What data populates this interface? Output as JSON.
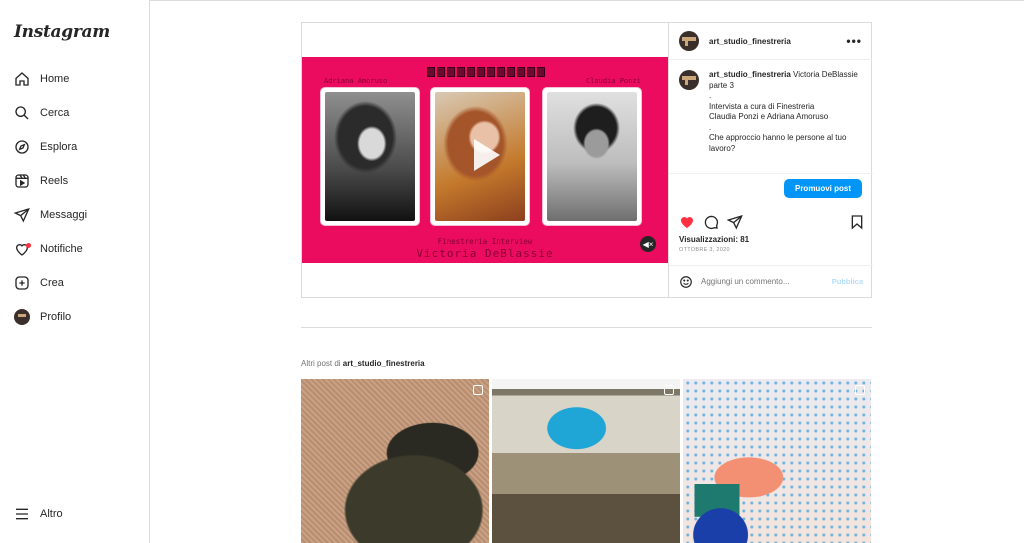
{
  "app": {
    "logo": "Instagram"
  },
  "sidebar": {
    "items": [
      {
        "label": "Home",
        "icon": "home-icon"
      },
      {
        "label": "Cerca",
        "icon": "search-icon"
      },
      {
        "label": "Esplora",
        "icon": "compass-icon"
      },
      {
        "label": "Reels",
        "icon": "reels-icon"
      },
      {
        "label": "Messaggi",
        "icon": "send-icon"
      },
      {
        "label": "Notifiche",
        "icon": "heart-icon"
      },
      {
        "label": "Crea",
        "icon": "plus-square-icon"
      },
      {
        "label": "Profilo",
        "icon": "avatar"
      }
    ],
    "more": {
      "label": "Altro",
      "icon": "menu-icon"
    }
  },
  "post": {
    "username": "art_studio_finestreria",
    "more_icon": "more-horizontal-icon",
    "media": {
      "left_name": "Adriana Amoruso",
      "right_name": "Claudia Ponzi",
      "series": "Finestreria Interview",
      "subject": "Victoria DeBlassie",
      "play_icon": "play-icon",
      "mute_icon": "mute-icon",
      "colors": {
        "background": "#ec0c5f"
      }
    },
    "caption": {
      "username": "art_studio_finestreria",
      "lines": [
        " Victoria DeBlassie",
        "parte 3",
        ".",
        "Intervista a cura di Finestreria",
        "Claudia Ponzi e Adriana Amoruso",
        ".",
        "Che approccio hanno le persone al tuo lavoro?"
      ]
    },
    "promote_label": "Promuovi post",
    "views": "Visualizzazioni: 81",
    "date": "OTTOBRE 3, 2020",
    "comment": {
      "placeholder": "Aggiungi un commento...",
      "publish_label": "Pubblica"
    }
  },
  "more_posts": {
    "prefix": "Altri post di ",
    "username": "art_studio_finestreria"
  },
  "colors": {
    "accent": "#0095f6",
    "like": "#ff3040",
    "border": "#dbdbdb"
  }
}
